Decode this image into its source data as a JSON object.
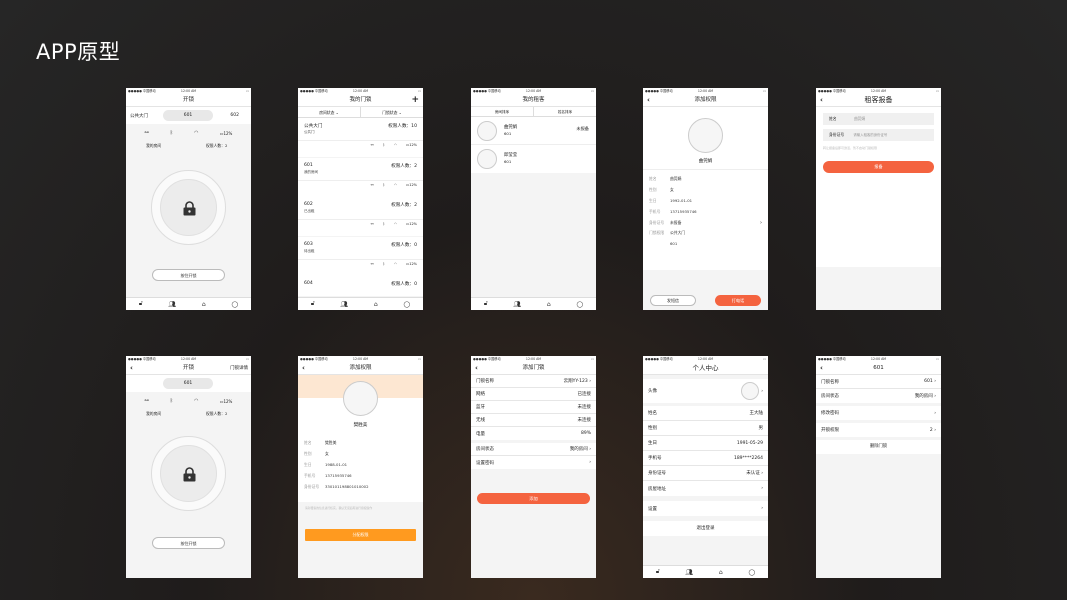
{
  "title": "APP原型",
  "status": {
    "carrier": "●●●●● 中国移动",
    "time": "12:00 AM",
    "battery": "▭"
  },
  "s1": {
    "title": "开锁",
    "tabs": [
      "公共大门",
      "601",
      "602"
    ],
    "battery": "12%",
    "room": "我的房间",
    "perm": "权限人数：2",
    "button": "按住开锁"
  },
  "s2": {
    "title": "我的门锁",
    "filters": [
      "房间状态",
      "门锁状态"
    ],
    "items": [
      {
        "name": "公共大门",
        "sub": "公共门",
        "perm": "权限人数：10"
      },
      {
        "name": "601",
        "sub": "我的房间",
        "perm": "权限人数：2"
      },
      {
        "name": "602",
        "sub": "已出租",
        "perm": "权限人数：2"
      },
      {
        "name": "603",
        "sub": "待出租",
        "perm": "权限人数：0"
      },
      {
        "name": "604",
        "sub": "",
        "perm": "权限人数：0"
      }
    ],
    "battery": "12%"
  },
  "s3": {
    "title": "我的租客",
    "sorts": [
      "房间排序",
      "姓名排序"
    ],
    "tenants": [
      {
        "name": "曲莞娟",
        "room": "601",
        "status": "未报备"
      },
      {
        "name": "邱莹莹",
        "room": "601",
        "status": ""
      }
    ]
  },
  "s4": {
    "title": "添加权限",
    "name": "曲莞娟",
    "fields": [
      {
        "k": "姓名",
        "v": "曲莞娟"
      },
      {
        "k": "性别",
        "v": "女"
      },
      {
        "k": "生日",
        "v": "1992-01-01"
      },
      {
        "k": "手机号",
        "v": "13715935746"
      },
      {
        "k": "身份证号",
        "v": "未报备"
      },
      {
        "k": "门锁权限",
        "v": "公共大门"
      },
      {
        "k": "",
        "v": "601"
      }
    ],
    "btn_left": "发短信",
    "btn_right": "打电话"
  },
  "s5": {
    "title": "租客报备",
    "name_label": "姓名",
    "name_value": "曲莞娟",
    "id_label": "身份证号",
    "id_placeholder": "请输入租客的身份证号",
    "note": "转让报备后即可激活，暂不启动门锁权限",
    "button": "报备"
  },
  "s6": {
    "title": "开锁",
    "right": "门锁详情",
    "tab": "601",
    "battery": "12%",
    "room": "我的房间",
    "perm": "权限人数：2",
    "button": "按住开锁"
  },
  "s7": {
    "title": "添加权限",
    "name": "樊胜美",
    "fields": [
      {
        "k": "姓名",
        "v": "樊胜美"
      },
      {
        "k": "性别",
        "v": "女"
      },
      {
        "k": "生日",
        "v": "1988-01-01"
      },
      {
        "k": "手机号",
        "v": "13715935746"
      },
      {
        "k": "身份证号",
        "v": "330101198801010002"
      }
    ],
    "note": "请对租客的信息进行核实，确认无误后再进行授权操作",
    "button": "分配权限"
  },
  "s8": {
    "title": "添加门锁",
    "rows": [
      {
        "k": "门锁名称",
        "v": "云翔YY-123"
      },
      {
        "k": "网络",
        "v": "已连接"
      },
      {
        "k": "蓝牙",
        "v": "未连接"
      },
      {
        "k": "无线",
        "v": "未连接"
      },
      {
        "k": "电量",
        "v": "89%"
      },
      {
        "k": "房间状态",
        "v": "我的房间"
      },
      {
        "k": "设置密码",
        "v": ""
      }
    ],
    "button": "添加"
  },
  "s9": {
    "title": "个人中心",
    "avatar_label": "头像",
    "rows": [
      {
        "k": "姓名",
        "v": "王大陆"
      },
      {
        "k": "性别",
        "v": "男"
      },
      {
        "k": "生日",
        "v": "1991-05-29"
      },
      {
        "k": "手机号",
        "v": "189****2264"
      },
      {
        "k": "身份证号",
        "v": "未认证"
      },
      {
        "k": "房屋地址",
        "v": ""
      }
    ],
    "settings": "设置",
    "logout": "退出登录"
  },
  "s10": {
    "title": "601",
    "rows": [
      {
        "k": "门锁名称",
        "v": "601"
      },
      {
        "k": "房间状态",
        "v": "我的房间"
      },
      {
        "k": "修改密码",
        "v": ""
      },
      {
        "k": "开锁权限",
        "v": "2"
      }
    ],
    "delete": "删除门锁"
  }
}
